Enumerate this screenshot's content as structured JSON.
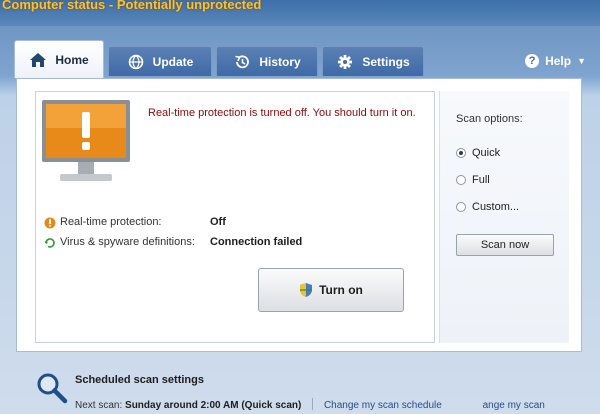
{
  "window": {
    "title": "Computer status - Potentially unprotected"
  },
  "tabs": [
    {
      "label": "Home",
      "icon": "home-icon",
      "active": true
    },
    {
      "label": "Update",
      "icon": "globe-update-icon",
      "active": false
    },
    {
      "label": "History",
      "icon": "history-icon",
      "active": false
    },
    {
      "label": "Settings",
      "icon": "gear-icon",
      "active": false
    }
  ],
  "help": {
    "label": "Help",
    "icon": "help-icon"
  },
  "alert": {
    "message": "Real-time protection is turned off. You should turn it on."
  },
  "status": [
    {
      "label": "Real-time protection:",
      "value": "Off",
      "icon": "warning-icon"
    },
    {
      "label": "Virus & spyware definitions:",
      "value": "Connection failed",
      "icon": "refresh-icon"
    }
  ],
  "turn_on_button": {
    "label": "Turn on",
    "icon": "shield-icon"
  },
  "scan_options": {
    "title": "Scan options:",
    "options": [
      {
        "label": "Quick",
        "selected": true
      },
      {
        "label": "Full",
        "selected": false
      },
      {
        "label": "Custom...",
        "selected": false
      }
    ],
    "scan_button": "Scan now"
  },
  "schedule": {
    "title": "Scheduled scan settings",
    "next_scan_label": "Next scan:",
    "next_scan_value": "Sunday around 2:00 AM (Quick scan)",
    "change_link": "Change my scan schedule",
    "partial_link": "ange my scan"
  },
  "colors": {
    "title_text": "#f7c23b",
    "alert_text": "#8a0a0a",
    "tab_blue": "#3f6aa6",
    "monitor_orange": "#e88a1a"
  }
}
